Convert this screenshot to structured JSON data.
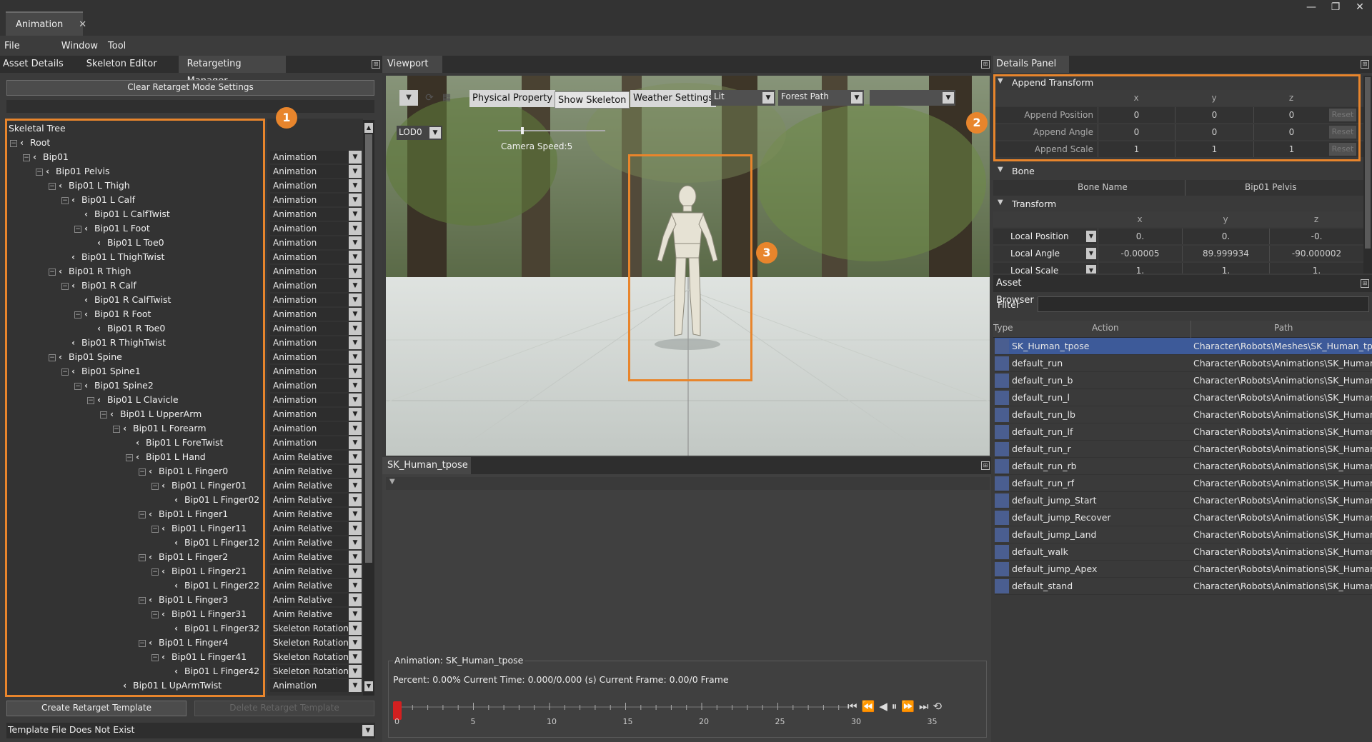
{
  "window": {
    "doc_tab": "Animation",
    "controls": [
      "—",
      "❐",
      "✕"
    ]
  },
  "menu": [
    "File",
    "Window",
    "Tool"
  ],
  "left_panel": {
    "tabs": [
      "Asset Details",
      "Skeleton Editor",
      "Retargeting Manager"
    ],
    "clear_button": "Clear Retarget Mode Settings",
    "tree_header": "Skeletal Tree",
    "badge": "1",
    "bones": [
      {
        "name": "Root",
        "depth": 0,
        "exp": true,
        "type": ""
      },
      {
        "name": "Bip01",
        "depth": 1,
        "exp": true,
        "type": "Animation"
      },
      {
        "name": "Bip01 Pelvis",
        "depth": 2,
        "exp": true,
        "type": "Animation"
      },
      {
        "name": "Bip01 L Thigh",
        "depth": 3,
        "exp": true,
        "type": "Animation"
      },
      {
        "name": "Bip01 L Calf",
        "depth": 4,
        "exp": true,
        "type": "Animation"
      },
      {
        "name": "Bip01 L CalfTwist",
        "depth": 5,
        "exp": false,
        "type": "Animation"
      },
      {
        "name": "Bip01 L Foot",
        "depth": 5,
        "exp": true,
        "type": "Animation"
      },
      {
        "name": "Bip01 L Toe0",
        "depth": 6,
        "exp": false,
        "type": "Animation"
      },
      {
        "name": "Bip01 L ThighTwist",
        "depth": 4,
        "exp": false,
        "type": "Animation"
      },
      {
        "name": "Bip01 R Thigh",
        "depth": 3,
        "exp": true,
        "type": "Animation"
      },
      {
        "name": "Bip01 R Calf",
        "depth": 4,
        "exp": true,
        "type": "Animation"
      },
      {
        "name": "Bip01 R CalfTwist",
        "depth": 5,
        "exp": false,
        "type": "Animation"
      },
      {
        "name": "Bip01 R Foot",
        "depth": 5,
        "exp": true,
        "type": "Animation"
      },
      {
        "name": "Bip01 R Toe0",
        "depth": 6,
        "exp": false,
        "type": "Animation"
      },
      {
        "name": "Bip01 R ThighTwist",
        "depth": 4,
        "exp": false,
        "type": "Animation"
      },
      {
        "name": "Bip01 Spine",
        "depth": 3,
        "exp": true,
        "type": "Animation"
      },
      {
        "name": "Bip01 Spine1",
        "depth": 4,
        "exp": true,
        "type": "Animation"
      },
      {
        "name": "Bip01 Spine2",
        "depth": 5,
        "exp": true,
        "type": "Animation"
      },
      {
        "name": "Bip01 L Clavicle",
        "depth": 6,
        "exp": true,
        "type": "Animation"
      },
      {
        "name": "Bip01 L UpperArm",
        "depth": 7,
        "exp": true,
        "type": "Animation"
      },
      {
        "name": "Bip01 L Forearm",
        "depth": 8,
        "exp": true,
        "type": "Animation"
      },
      {
        "name": "Bip01 L ForeTwist",
        "depth": 9,
        "exp": false,
        "type": "Animation"
      },
      {
        "name": "Bip01 L Hand",
        "depth": 9,
        "exp": true,
        "type": "Anim Relative"
      },
      {
        "name": "Bip01 L Finger0",
        "depth": 10,
        "exp": true,
        "type": "Anim Relative"
      },
      {
        "name": "Bip01 L Finger01",
        "depth": 11,
        "exp": true,
        "type": "Anim Relative"
      },
      {
        "name": "Bip01 L Finger02",
        "depth": 12,
        "exp": false,
        "type": "Anim Relative"
      },
      {
        "name": "Bip01 L Finger1",
        "depth": 10,
        "exp": true,
        "type": "Anim Relative"
      },
      {
        "name": "Bip01 L Finger11",
        "depth": 11,
        "exp": true,
        "type": "Anim Relative"
      },
      {
        "name": "Bip01 L Finger12",
        "depth": 12,
        "exp": false,
        "type": "Anim Relative"
      },
      {
        "name": "Bip01 L Finger2",
        "depth": 10,
        "exp": true,
        "type": "Anim Relative"
      },
      {
        "name": "Bip01 L Finger21",
        "depth": 11,
        "exp": true,
        "type": "Anim Relative"
      },
      {
        "name": "Bip01 L Finger22",
        "depth": 12,
        "exp": false,
        "type": "Anim Relative"
      },
      {
        "name": "Bip01 L Finger3",
        "depth": 10,
        "exp": true,
        "type": "Anim Relative"
      },
      {
        "name": "Bip01 L Finger31",
        "depth": 11,
        "exp": true,
        "type": "Anim Relative"
      },
      {
        "name": "Bip01 L Finger32",
        "depth": 12,
        "exp": false,
        "type": "Skeleton Rotation"
      },
      {
        "name": "Bip01 L Finger4",
        "depth": 10,
        "exp": true,
        "type": "Skeleton Rotation"
      },
      {
        "name": "Bip01 L Finger41",
        "depth": 11,
        "exp": true,
        "type": "Skeleton Rotation"
      },
      {
        "name": "Bip01 L Finger42",
        "depth": 12,
        "exp": false,
        "type": "Skeleton Rotation"
      },
      {
        "name": "Bip01 L UpArmTwist",
        "depth": 8,
        "exp": false,
        "type": "Animation"
      }
    ],
    "create_button": "Create Retarget Template",
    "delete_button": "Delete Retarget Template",
    "template_status": "Template File Does Not Exist"
  },
  "viewport": {
    "tab": "Viewport",
    "toolbar": {
      "physical_property": "Physical Property",
      "show_skeleton": "Show Skeleton",
      "weather_settings": "Weather Settings",
      "lit": "Lit",
      "forest_path": "Forest Path",
      "empty_select": ""
    },
    "lod": "LOD0",
    "camera_speed": "Camera Speed:5",
    "badge": "3"
  },
  "anim_panel": {
    "tab": "SK_Human_tpose",
    "group_title": "Animation: SK_Human_tpose",
    "status": "Percent: 0.00% Current Time: 0.000/0.000 (s) Current Frame: 0.00/0 Frame",
    "ticks": [
      "0",
      "5",
      "10",
      "15",
      "20",
      "25",
      "30",
      "35"
    ],
    "playback_icons": [
      "⏮",
      "⏪",
      "◀",
      "⏸",
      "⏩",
      "⏭",
      "⟲"
    ]
  },
  "details": {
    "tab": "Details Panel",
    "badge": "2",
    "append_transform": {
      "title": "Append Transform",
      "headers": [
        "x",
        "y",
        "z"
      ],
      "rows": [
        {
          "label": "Append Position",
          "x": "0",
          "y": "0",
          "z": "0",
          "reset": "Reset"
        },
        {
          "label": "Append Angle",
          "x": "0",
          "y": "0",
          "z": "0",
          "reset": "Reset"
        },
        {
          "label": "Append Scale",
          "x": "1",
          "y": "1",
          "z": "1",
          "reset": "Reset"
        }
      ]
    },
    "bone": {
      "title": "Bone",
      "name_label": "Bone Name",
      "name_value": "Bip01 Pelvis"
    },
    "transform": {
      "title": "Transform",
      "headers": [
        "x",
        "y",
        "z"
      ],
      "rows": [
        {
          "label": "Local Position",
          "x": "0.",
          "y": "0.",
          "z": "-0."
        },
        {
          "label": "Local Angle",
          "x": "-0.00005",
          "y": "89.999934",
          "z": "-90.000002"
        },
        {
          "label": "Local Scale",
          "x": "1.",
          "y": "1.",
          "z": "1."
        }
      ]
    }
  },
  "asset_browser": {
    "tab": "Asset Browser",
    "filter_label": "Filter",
    "filter_value": "",
    "columns": [
      "Type",
      "Action",
      "Path"
    ],
    "rows": [
      {
        "name": "SK_Human_tpose",
        "path": "Character\\Robots\\Meshes\\SK_Human_tp...",
        "selected": true
      },
      {
        "name": "default_run",
        "path": "Character\\Robots\\Animations\\SK_Human...",
        "selected": false
      },
      {
        "name": "default_run_b",
        "path": "Character\\Robots\\Animations\\SK_Human...",
        "selected": false
      },
      {
        "name": "default_run_l",
        "path": "Character\\Robots\\Animations\\SK_Human...",
        "selected": false
      },
      {
        "name": "default_run_lb",
        "path": "Character\\Robots\\Animations\\SK_Human...",
        "selected": false
      },
      {
        "name": "default_run_lf",
        "path": "Character\\Robots\\Animations\\SK_Human...",
        "selected": false
      },
      {
        "name": "default_run_r",
        "path": "Character\\Robots\\Animations\\SK_Human...",
        "selected": false
      },
      {
        "name": "default_run_rb",
        "path": "Character\\Robots\\Animations\\SK_Human...",
        "selected": false
      },
      {
        "name": "default_run_rf",
        "path": "Character\\Robots\\Animations\\SK_Human...",
        "selected": false
      },
      {
        "name": "default_jump_Start",
        "path": "Character\\Robots\\Animations\\SK_Human...",
        "selected": false
      },
      {
        "name": "default_jump_Recover",
        "path": "Character\\Robots\\Animations\\SK_Human...",
        "selected": false
      },
      {
        "name": "default_jump_Land",
        "path": "Character\\Robots\\Animations\\SK_Human...",
        "selected": false
      },
      {
        "name": "default_walk",
        "path": "Character\\Robots\\Animations\\SK_Human...",
        "selected": false
      },
      {
        "name": "default_jump_Apex",
        "path": "Character\\Robots\\Animations\\SK_Human...",
        "selected": false
      },
      {
        "name": "default_stand",
        "path": "Character\\Robots\\Animations\\SK_Human...",
        "selected": false
      }
    ]
  },
  "colors": {
    "accent": "#e8852c",
    "selection": "#3d5a99"
  }
}
